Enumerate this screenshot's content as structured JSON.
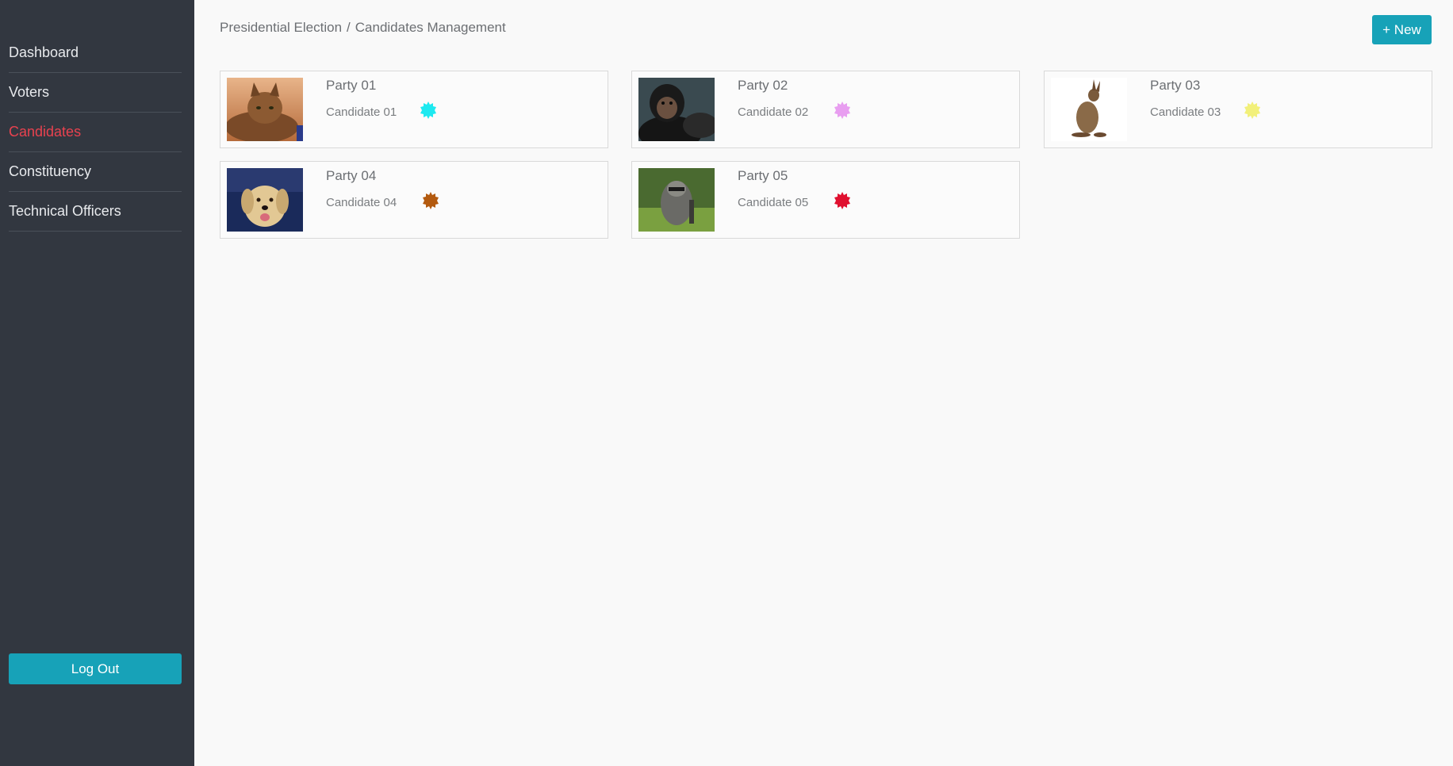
{
  "sidebar": {
    "items": [
      {
        "label": "Dashboard",
        "active": false
      },
      {
        "label": "Voters",
        "active": false
      },
      {
        "label": "Candidates",
        "active": true
      },
      {
        "label": "Constituency",
        "active": false
      },
      {
        "label": "Technical Officers",
        "active": false
      }
    ],
    "logout_label": "Log Out"
  },
  "header": {
    "breadcrumb_parent": "Presidential Election",
    "breadcrumb_separator": "/",
    "breadcrumb_current": "Candidates Management",
    "new_button_label": "+ New"
  },
  "colors": {
    "sidebar_bg": "#323740",
    "active_nav": "#e8424f",
    "accent": "#17a2b8"
  },
  "candidates": [
    {
      "party": "Party 01",
      "candidate": "Candidate 01",
      "symbol_color": "#1de9f0",
      "photo": "cat-photo"
    },
    {
      "party": "Party 02",
      "candidate": "Candidate 02",
      "symbol_color": "#e89ef0",
      "photo": "chimpanzee-photo"
    },
    {
      "party": "Party 03",
      "candidate": "Candidate 03",
      "symbol_color": "#f2f07a",
      "photo": "kangaroo-photo"
    },
    {
      "party": "Party 04",
      "candidate": "Candidate 04",
      "symbol_color": "#b35a0f",
      "photo": "dog-photo"
    },
    {
      "party": "Party 05",
      "candidate": "Candidate 05",
      "symbol_color": "#e0102f",
      "photo": "raccoon-photo"
    }
  ]
}
